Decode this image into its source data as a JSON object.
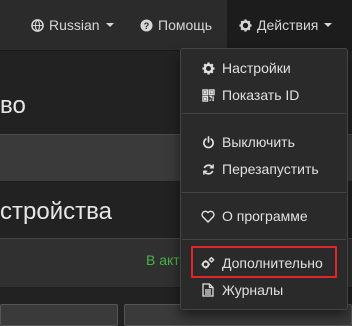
{
  "navbar": {
    "language": {
      "label": "Russian",
      "icon": "globe-icon"
    },
    "help": {
      "label": "Помощь",
      "icon": "question-circle-icon"
    },
    "actions": {
      "label": "Действия",
      "icon": "gear-icon"
    }
  },
  "background": {
    "title_fragment": "во",
    "section_title_fragment": "стройства",
    "status_fragment": "В акт"
  },
  "menu": {
    "items": [
      {
        "label": "Настройки",
        "icon": "gear-icon"
      },
      {
        "label": "Показать ID",
        "icon": "qr-code-icon"
      },
      {
        "label": "Выключить",
        "icon": "power-icon"
      },
      {
        "label": "Перезапустить",
        "icon": "refresh-icon"
      },
      {
        "label": "О программе",
        "icon": "heart-icon"
      },
      {
        "label": "Дополнительно",
        "icon": "gears-icon"
      },
      {
        "label": "Журналы",
        "icon": "document-icon"
      }
    ]
  },
  "colors": {
    "highlight": "#e0262b",
    "status_green": "#47b347"
  }
}
